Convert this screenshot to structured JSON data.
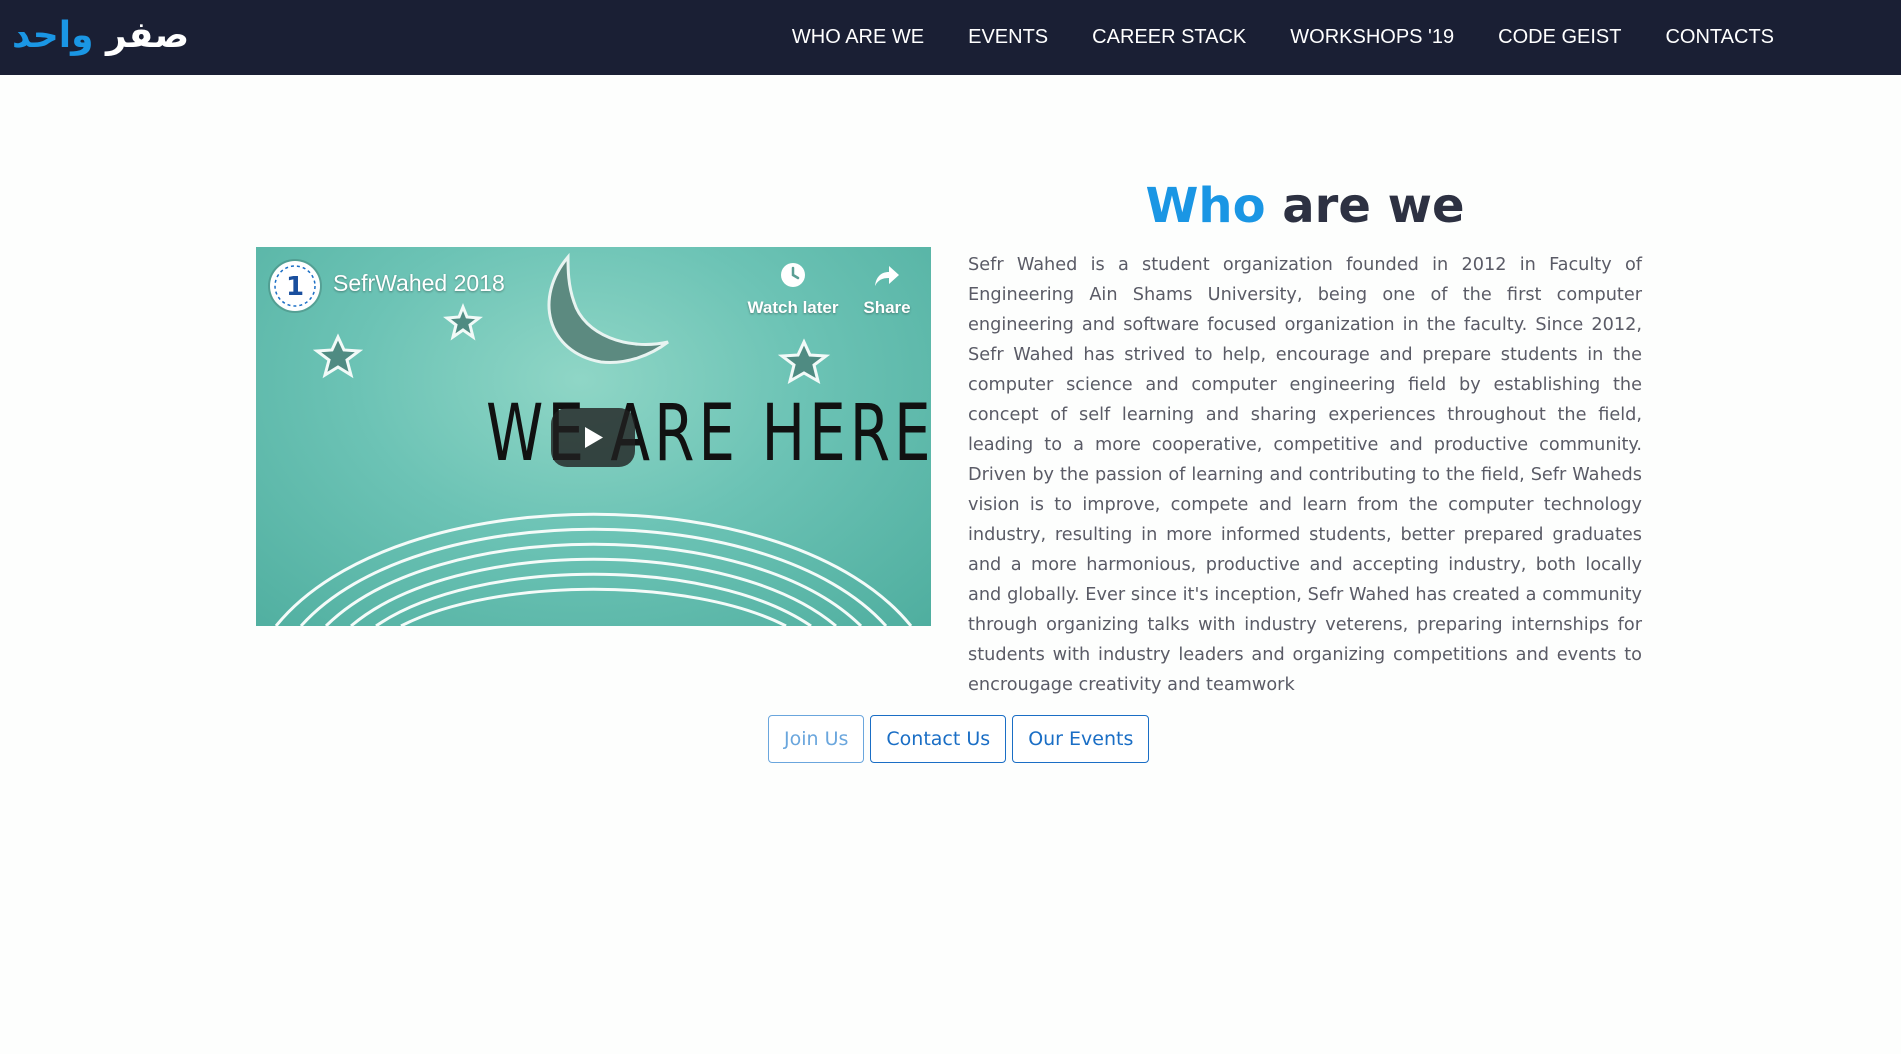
{
  "brand": {
    "word1": "صفر",
    "word2": "واحد"
  },
  "nav": {
    "items": [
      {
        "label": "WHO ARE WE"
      },
      {
        "label": "EVENTS"
      },
      {
        "label": "CAREER STACK"
      },
      {
        "label": "WORKSHOPS '19"
      },
      {
        "label": "CODE GEIST"
      },
      {
        "label": "CONTACTS"
      }
    ]
  },
  "video": {
    "title": "SefrWahed 2018",
    "watch_later_label": "Watch later",
    "share_label": "Share",
    "overlay_text": "WE ARE HERE",
    "channel_badge": "1"
  },
  "about": {
    "heading_accent": "Who",
    "heading_rest": " are we",
    "body": "Sefr Wahed is a student organization founded in 2012 in Faculty of Engineering Ain Shams University, being one of the first computer engineering and software focused organization in the faculty. Since 2012, Sefr Wahed has strived to help, encourage and prepare students in the computer science and computer engineering field by establishing the concept of self learning and sharing experiences throughout the field, leading to a more cooperative, competitive and productive community. Driven by the passion of learning and contributing to the field, Sefr Waheds vision is to improve, compete and learn from the computer technology industry, resulting in more informed students, better prepared graduates and a more harmonious, productive and accepting industry, both locally and globally. Ever since it's inception, Sefr Wahed has created a community through organizing talks with industry veterens, preparing internships for students with industry leaders and organizing competitions and events to encrougage creativity and teamwork"
  },
  "buttons": {
    "join": "Join Us",
    "contact": "Contact Us",
    "events": "Our Events"
  },
  "colors": {
    "navbar": "#1a1f34",
    "accent": "#1a96e4",
    "button_border": "#1a6ec5",
    "heading": "#2d3142",
    "body_text": "#5a5b66",
    "video_bg": "#6cc3b5"
  }
}
